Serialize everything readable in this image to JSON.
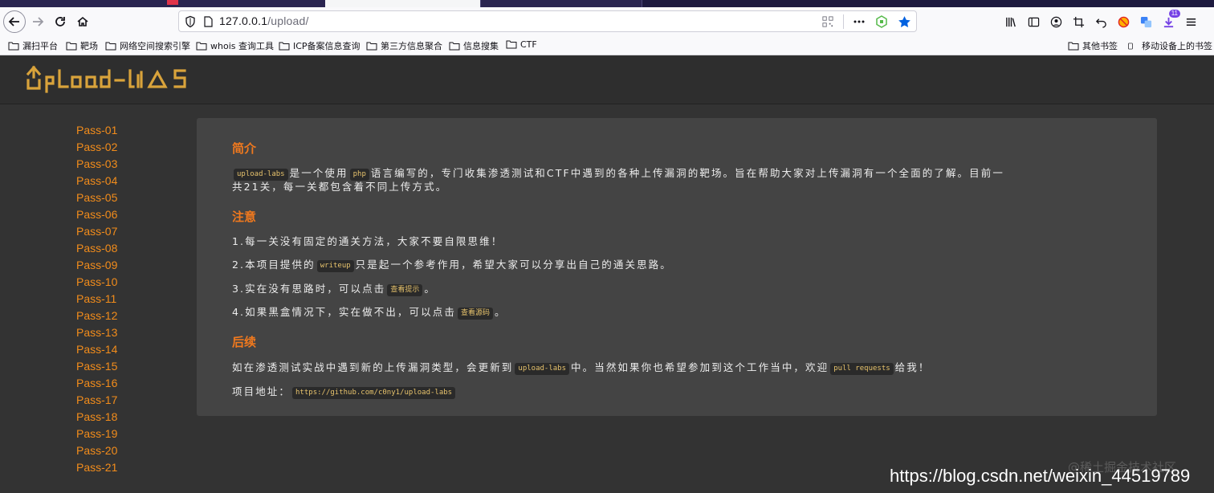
{
  "browser": {
    "url": {
      "host": "127.0.0.1",
      "path": "/upload/"
    },
    "bookmarks": [
      {
        "label": "漏扫平台"
      },
      {
        "label": "靶场"
      },
      {
        "label": "网络空间搜索引擎"
      },
      {
        "label": "whois 查询工具"
      },
      {
        "label": "ICP备案信息查询"
      },
      {
        "label": "第三方信息聚合"
      },
      {
        "label": "信息搜集"
      },
      {
        "label": "CTF"
      }
    ],
    "bookmarks_right": [
      {
        "label": "其他书签"
      },
      {
        "label": "移动设备上的书签"
      }
    ],
    "extension_badge": "11",
    "accent_color": "#0061e0",
    "tabstrip_color": "#1d1a3f"
  },
  "site": {
    "logo_text": "UpLoad-labs",
    "logo_color": "#d9a33b",
    "link_color": "#f28c1b",
    "heading_color": "#f0791e"
  },
  "sidebar": {
    "items": [
      "Pass-01",
      "Pass-02",
      "Pass-03",
      "Pass-04",
      "Pass-05",
      "Pass-06",
      "Pass-07",
      "Pass-08",
      "Pass-09",
      "Pass-10",
      "Pass-11",
      "Pass-12",
      "Pass-13",
      "Pass-14",
      "Pass-15",
      "Pass-16",
      "Pass-17",
      "Pass-18",
      "Pass-19",
      "Pass-20",
      "Pass-21"
    ]
  },
  "intro": {
    "heading": "简介",
    "line1": {
      "code1": "upload-labs",
      "t1": "是一个使用",
      "code2": "php",
      "t2": "语言编写的，专门收集渗透测试和CTF中遇到的各种上传漏洞的靶场。旨在帮助大家对上传漏洞有一个全面的了解。目前一"
    },
    "line2": "共21关，每一关都包含着不同上传方式。"
  },
  "notes": {
    "heading": "注意",
    "item1": "1.每一关没有固定的通关方法，大家不要自限思维！",
    "item2": {
      "t1": "2.本项目提供的",
      "code": "writeup",
      "t2": "只是起一个参考作用，希望大家可以分享出自己的通关思路。"
    },
    "item3": {
      "t1": "3.实在没有思路时，可以点击",
      "code": "查看提示",
      "t2": "。"
    },
    "item4": {
      "t1": "4.如果黑盒情况下，实在做不出，可以点击",
      "code": "查看源码",
      "t2": "。"
    }
  },
  "followup": {
    "heading": "后续",
    "line1": {
      "t1": "如在渗透测试实战中遇到新的上传漏洞类型，会更新到",
      "code1": "upload-labs",
      "t2": "中。当然如果你也希望参加到这个工作当中，欢迎",
      "code2": "pull requests",
      "t3": "给我！"
    },
    "line2": {
      "t1": "项目地址：",
      "code": "https://github.com/c0ny1/upload-labs"
    }
  },
  "watermark": {
    "faint": "@稀土掘金技术社区",
    "url": "https://blog.csdn.net/weixin_44519789"
  }
}
